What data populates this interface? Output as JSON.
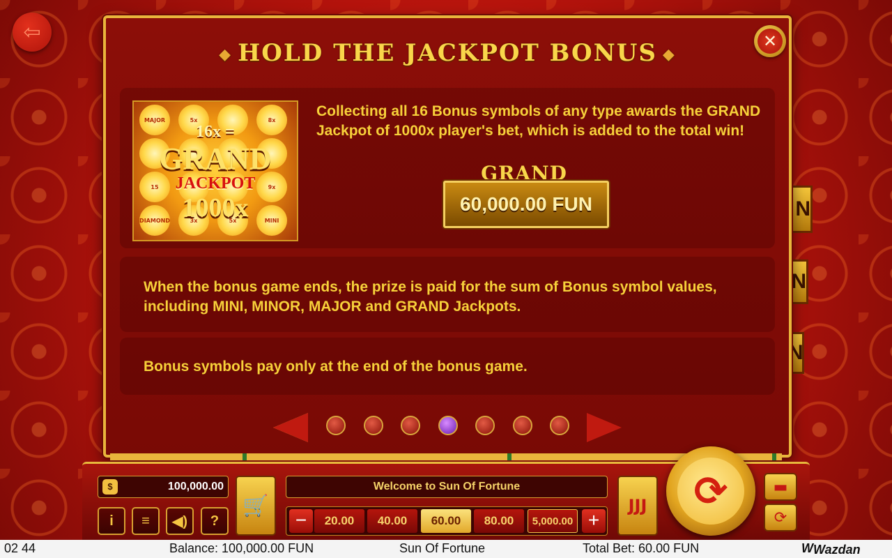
{
  "dialog": {
    "title": "HOLD THE JACKPOT BONUS",
    "paragraph1": "Collecting all 16 Bonus symbols of any type awards the GRAND Jackpot of 1000x player's bet, which is added to the total win!",
    "grand_label": "GRAND",
    "grand_value": "60,000.00 FUN",
    "paragraph2": "When the bonus game ends, the prize is paid for the sum of Bonus symbol values, including MINI, MINOR, MAJOR and GRAND Jackpots.",
    "paragraph3": "Bonus symbols pay only at the end of the bonus game.",
    "symbol_image": {
      "line1": "16x =",
      "line2": "GRAND",
      "line3": "JACKPOT",
      "line4": "1000x",
      "coin_labels": [
        "MAJOR",
        "5x",
        "",
        "8x",
        "",
        "",
        "",
        "",
        "15",
        "",
        "",
        "9x",
        "DIAMOND",
        "3x",
        "5x",
        "MINI"
      ]
    },
    "pagination": {
      "total": 7,
      "active_index": 3
    }
  },
  "controls": {
    "balance": "100,000.00",
    "message": "Welcome to Sun Of Fortune",
    "bets": [
      "20.00",
      "40.00",
      "60.00",
      "80.00",
      "5,000.00"
    ],
    "selected_bet_index": 2,
    "info_label": "i",
    "menu_label": "≡",
    "sound_label": "◀)",
    "help_label": "?",
    "minus_label": "−",
    "plus_label": "+",
    "turbo_label": "JJJ"
  },
  "status_bar": {
    "time": "02 44",
    "balance": "Balance: 100,000.00 FUN",
    "game_name": "Sun Of Fortune",
    "total_bet": "Total Bet: 60.00 FUN",
    "logo": "Wazdan"
  },
  "background_peek": [
    "N",
    "N",
    "N"
  ],
  "colors": {
    "accent_gold": "#f7d13a",
    "dialog_red": "#8c0e08",
    "active_dot": "#8a2be2"
  }
}
